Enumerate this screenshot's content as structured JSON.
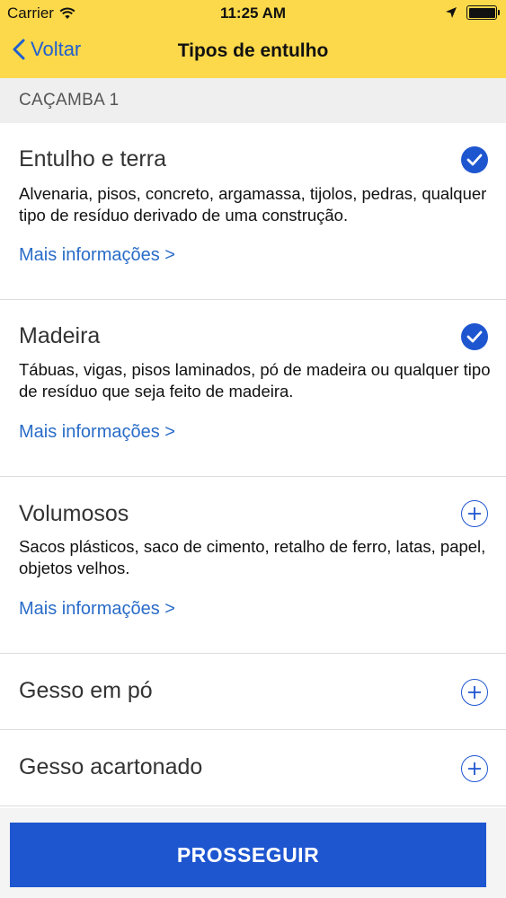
{
  "status_bar": {
    "carrier": "Carrier",
    "time": "11:25 AM",
    "icons": [
      "wifi-icon",
      "location-arrow-icon",
      "battery-icon"
    ]
  },
  "nav": {
    "back_label": "Voltar",
    "title": "Tipos de entulho"
  },
  "section": {
    "label": "CAÇAMBA 1"
  },
  "items": [
    {
      "name": "Entulho e terra",
      "description": "Alvenaria, pisos, concreto, argamassa, tijolos, pedras, qualquer tipo de resíduo derivado de uma construção.",
      "more_label": "Mais informações >",
      "selected": true
    },
    {
      "name": "Madeira",
      "description": "Tábuas, vigas, pisos laminados, pó de madeira ou qualquer tipo de resíduo que seja feito de madeira.",
      "more_label": "Mais informações >",
      "selected": true
    },
    {
      "name": "Volumosos",
      "description": "Sacos plásticos, saco de cimento, retalho de ferro, latas, papel, objetos velhos.",
      "more_label": "Mais informações >",
      "selected": false
    },
    {
      "name": "Gesso em pó",
      "selected": false
    },
    {
      "name": "Gesso acartonado",
      "selected": false
    }
  ],
  "footer": {
    "proceed_label": "PROSSEGUIR"
  },
  "colors": {
    "header_yellow": "#fcd94a",
    "accent_blue": "#1e56d0",
    "link_blue": "#2a6cc8"
  }
}
